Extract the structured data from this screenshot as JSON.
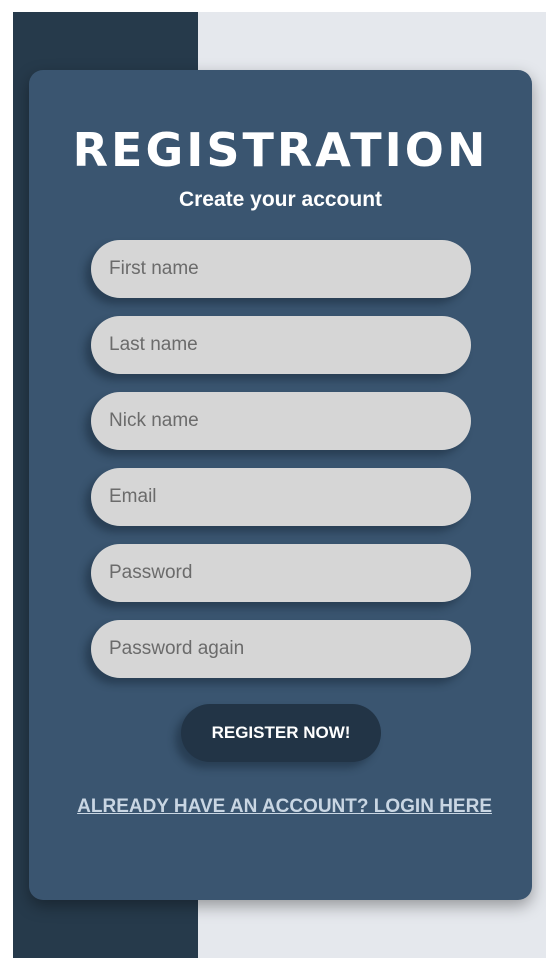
{
  "form": {
    "title": "REGISTRATION",
    "subtitle": "Create your account",
    "fields": [
      {
        "placeholder": "First name",
        "value": ""
      },
      {
        "placeholder": "Last name",
        "value": ""
      },
      {
        "placeholder": "Nick name",
        "value": ""
      },
      {
        "placeholder": "Email",
        "value": ""
      },
      {
        "placeholder": "Password",
        "value": ""
      },
      {
        "placeholder": "Password again",
        "value": ""
      }
    ],
    "submit_label": "REGISTER NOW!",
    "login_link": "ALREADY HAVE AN ACCOUNT? LOGIN HERE"
  },
  "colors": {
    "left_panel": "#263a4b",
    "right_panel": "#e5e8ed",
    "card": "#3a5570",
    "input_bg": "#d6d6d6",
    "button_bg": "#223446",
    "link": "#c9d6e3"
  }
}
